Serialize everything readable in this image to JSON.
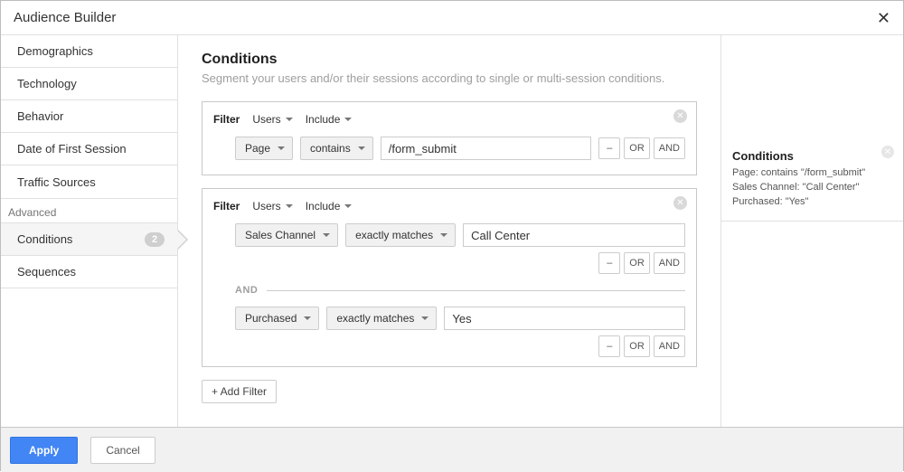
{
  "header": {
    "title": "Audience Builder"
  },
  "sidebar": {
    "items": [
      {
        "label": "Demographics"
      },
      {
        "label": "Technology"
      },
      {
        "label": "Behavior"
      },
      {
        "label": "Date of First Session"
      },
      {
        "label": "Traffic Sources"
      }
    ],
    "advanced_label": "Advanced",
    "advanced_items": [
      {
        "label": "Conditions",
        "badge": "2",
        "active": true
      },
      {
        "label": "Sequences"
      }
    ]
  },
  "main": {
    "title": "Conditions",
    "subtitle": "Segment your users and/or their sessions according to single or multi-session conditions.",
    "filters": [
      {
        "filter_label": "Filter",
        "scope": "Users",
        "mode": "Include",
        "rules": [
          {
            "dimension": "Page",
            "operator": "contains",
            "value": "/form_submit"
          }
        ]
      },
      {
        "filter_label": "Filter",
        "scope": "Users",
        "mode": "Include",
        "rules": [
          {
            "dimension": "Sales Channel",
            "operator": "exactly matches",
            "value": "Call Center"
          },
          {
            "dimension": "Purchased",
            "operator": "exactly matches",
            "value": "Yes"
          }
        ],
        "and_label": "AND"
      }
    ],
    "ops": {
      "remove": "–",
      "or": "OR",
      "and": "AND"
    },
    "add_filter_label": "+ Add Filter"
  },
  "summary": {
    "title": "Conditions",
    "lines": [
      "Page: contains \"/form_submit\"",
      "Sales Channel: \"Call Center\"",
      "Purchased: \"Yes\""
    ]
  },
  "footer": {
    "apply": "Apply",
    "cancel": "Cancel"
  }
}
